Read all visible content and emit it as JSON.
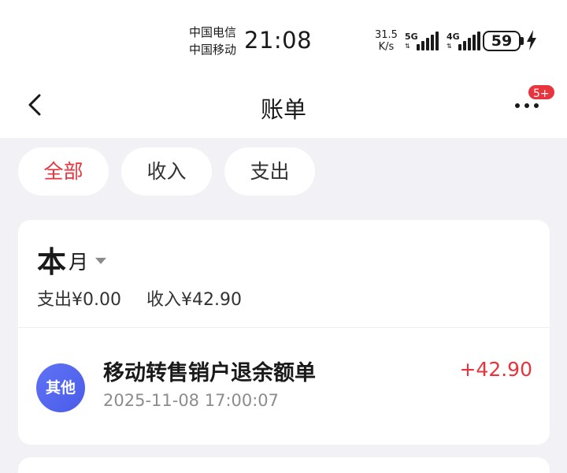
{
  "status_bar": {
    "carrier_1": "中国电信",
    "carrier_2": "中国移动",
    "time": "21:08",
    "net_speed_value": "31.5",
    "net_speed_unit": "K/s",
    "signal_1_label": "5G",
    "signal_2_label": "4G",
    "battery_level": "59",
    "icons": [
      "signal-5g-icon",
      "signal-4g-icon",
      "battery-icon",
      "charging-icon"
    ]
  },
  "header": {
    "title": "账单",
    "badge": "5+",
    "icons": [
      "back-chevron-icon",
      "more-icon"
    ]
  },
  "filters": {
    "all": "全部",
    "income": "收入",
    "expense": "支出",
    "active": "all"
  },
  "month": {
    "label": "本",
    "suffix": "月",
    "expense_summary": "支出¥0.00",
    "income_summary": "收入¥42.90"
  },
  "transactions": [
    {
      "avatar_label": "其他",
      "title": "移动转售销户退余额单",
      "time": "2025-11-08 17:00:07",
      "amount": "+42.90"
    }
  ],
  "colors": {
    "accent": "#e8343c",
    "avatar": "#5466ef",
    "background": "#f2f2f6"
  }
}
